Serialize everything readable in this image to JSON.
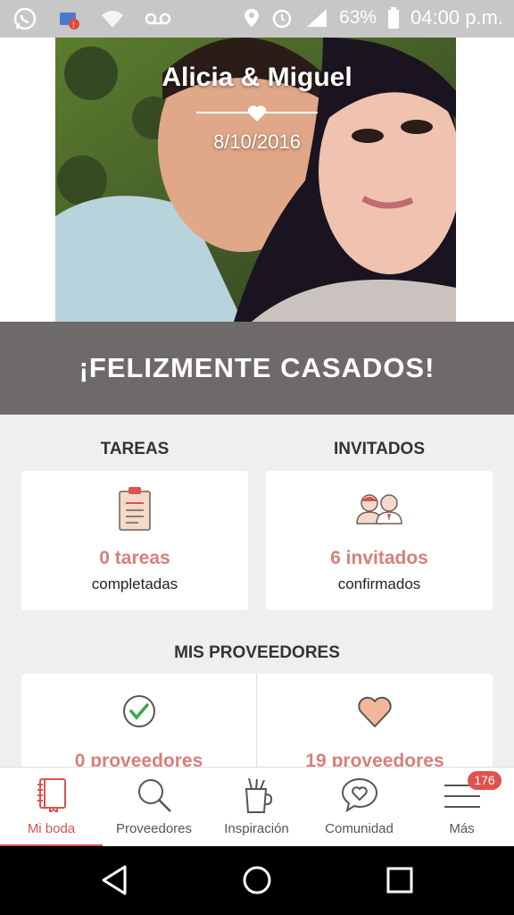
{
  "status_bar": {
    "battery": "63%",
    "time": "04:00 p.m.",
    "network": "LTE"
  },
  "hero": {
    "couple_name": "Alicia & Miguel",
    "date": "8/10/2016"
  },
  "banner": {
    "text": "¡FELIZMENTE CASADOS!"
  },
  "tasks": {
    "title": "TAREAS",
    "count": "0 tareas",
    "sub": "completadas"
  },
  "guests": {
    "title": "INVITADOS",
    "count": "6 invitados",
    "sub": "confirmados"
  },
  "providers": {
    "title": "MIS PROVEEDORES",
    "left_count": "0 proveedores",
    "right_count": "19 proveedores"
  },
  "nav": {
    "items": [
      {
        "label": "Mi boda",
        "icon": "notebook-icon",
        "active": true
      },
      {
        "label": "Proveedores",
        "icon": "search-icon"
      },
      {
        "label": "Inspiración",
        "icon": "inspiration-icon"
      },
      {
        "label": "Comunidad",
        "icon": "chat-heart-icon"
      },
      {
        "label": "Más",
        "icon": "menu-icon"
      }
    ],
    "more_badge": "176"
  },
  "colors": {
    "accent": "#d9534f",
    "accent_soft": "#d77f7a",
    "banner": "#6e6a69"
  }
}
